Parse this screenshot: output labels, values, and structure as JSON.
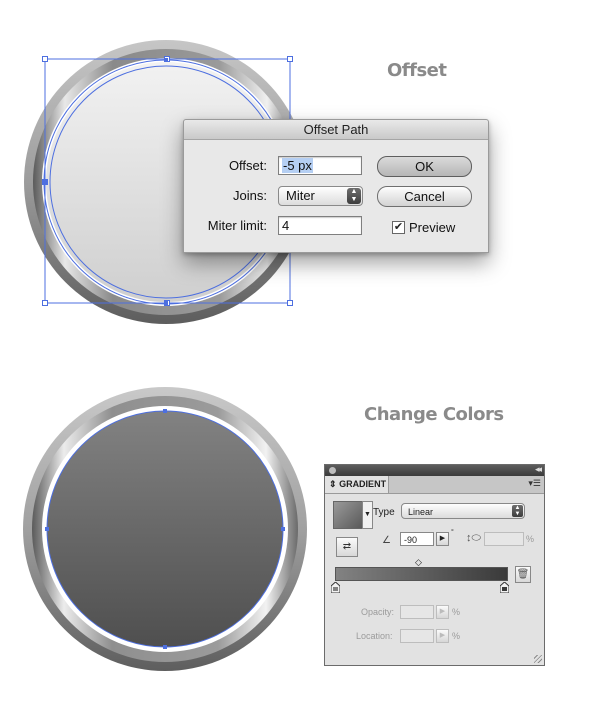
{
  "headings": {
    "offset": "Offset",
    "change_colors": "Change Colors"
  },
  "dialog": {
    "title": "Offset Path",
    "offset_label": "Offset:",
    "offset_value": "-5 px",
    "joins_label": "Joins:",
    "joins_value": "Miter",
    "miter_label": "Miter limit:",
    "miter_value": "4",
    "ok_label": "OK",
    "cancel_label": "Cancel",
    "preview_label": "Preview",
    "preview_checked": true
  },
  "gradient_panel": {
    "tab_label": "GRADIENT",
    "type_label": "Type",
    "type_value": "Linear",
    "angle_value": "-90",
    "angle_unit": "°",
    "aspect_unit": "%",
    "opacity_label": "Opacity:",
    "opacity_unit": "%",
    "location_label": "Location:",
    "location_unit": "%",
    "colors": {
      "start": "#828282",
      "end": "#3a3a3a"
    }
  },
  "icons": [
    "chevron-up-down-icon",
    "panel-menu-icon",
    "reverse-gradient-icon",
    "angle-icon",
    "aspect-ratio-icon",
    "trash-icon",
    "checkmark-icon"
  ]
}
